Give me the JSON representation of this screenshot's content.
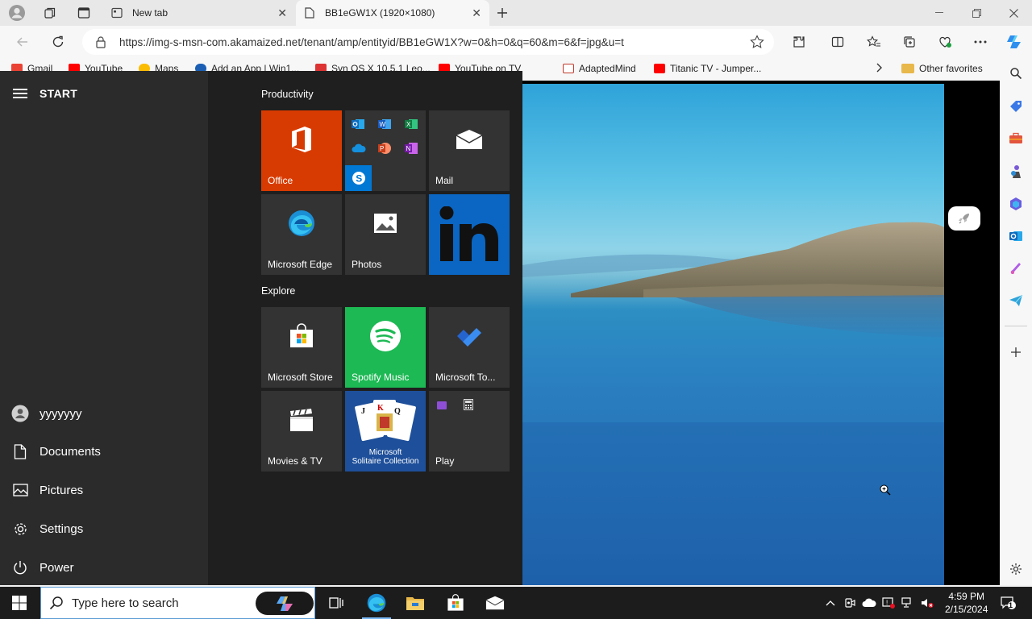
{
  "browser": {
    "tabs": [
      {
        "label": "New tab"
      },
      {
        "label": "BB1eGW1X (1920×1080)"
      }
    ],
    "url": "https://img-s-msn-com.akamaized.net/tenant/amp/entityid/BB1eGW1X?w=0&h=0&q=60&m=6&f=jpg&u=t",
    "favorites": [
      {
        "label": "Gmail",
        "color": "#ea4335"
      },
      {
        "label": "YouTube",
        "color": "#ff0000"
      },
      {
        "label": "Maps",
        "color": "#fbbc04"
      },
      {
        "label": "Add an App | Win1...",
        "color": "#1a5fb4"
      },
      {
        "label": "Syn OS X 10.5.1 Leo...",
        "color": "#d33"
      },
      {
        "label": "YouTube on TV",
        "color": "#ff0000"
      },
      {
        "label": "AdaptedMind",
        "color": "#c0392b"
      },
      {
        "label": "Titanic TV - Jumper...",
        "color": "#ff0000"
      },
      {
        "label": "Other favorites",
        "color": "#e8b84b"
      }
    ]
  },
  "start_menu": {
    "title": "START",
    "side_items": [
      {
        "label": "yyyyyyy",
        "icon": "user-icon"
      },
      {
        "label": "Documents",
        "icon": "document-icon"
      },
      {
        "label": "Pictures",
        "icon": "pictures-icon"
      },
      {
        "label": "Settings",
        "icon": "gear-icon"
      },
      {
        "label": "Power",
        "icon": "power-icon"
      }
    ],
    "groups": [
      {
        "label": "Productivity"
      },
      {
        "label": "Explore"
      }
    ],
    "tiles": {
      "office": "Office",
      "mail": "Mail",
      "edge": "Microsoft Edge",
      "photos": "Photos",
      "store": "Microsoft Store",
      "spotify": "Spotify Music",
      "todo": "Microsoft To...",
      "movies": "Movies & TV",
      "solitaire_line1": "Microsoft",
      "solitaire_line2": "Solitaire Collection",
      "play": "Play"
    },
    "colors": {
      "office": "#d83b01",
      "spotify": "#1db954",
      "linkedin": "#0a66c2",
      "solitaire": "#1e4f9a"
    }
  },
  "taskbar": {
    "search_placeholder": "Type here to search",
    "time": "4:59 PM",
    "date": "2/15/2024",
    "notification_count": "1"
  }
}
